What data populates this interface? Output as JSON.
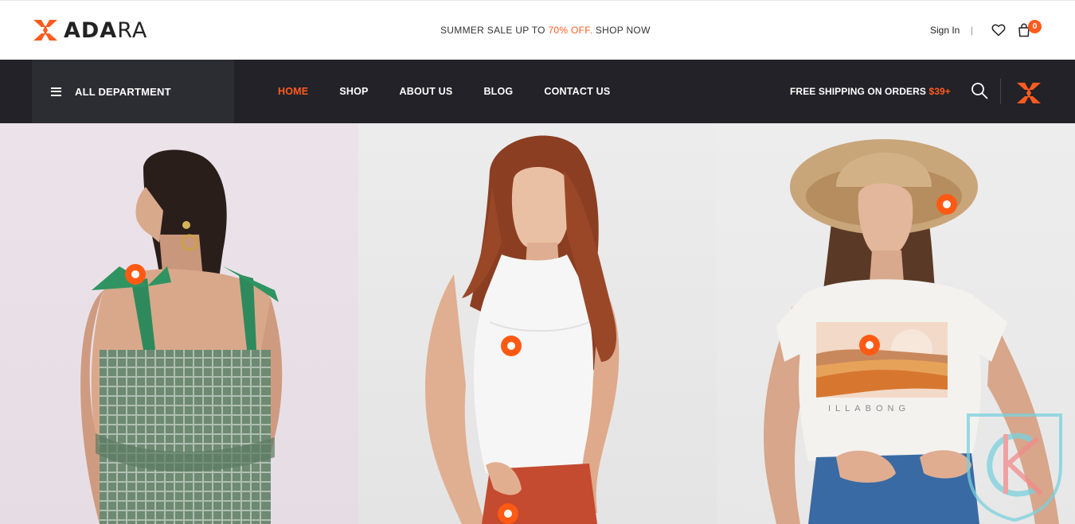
{
  "brand": {
    "name_bold": "ADA",
    "name_light": "RA",
    "accent_color": "#ff5b1f"
  },
  "topbar": {
    "promo_prefix": "SUMMER SALE UP TO",
    "promo_highlight": "70% OFF.",
    "promo_suffix": "SHOP NOW",
    "sign_in": "Sign In",
    "separator": "|",
    "cart_count": "0",
    "icons": [
      "heart-icon",
      "shopping-bag-icon"
    ]
  },
  "nav": {
    "department_label": "ALL DEPARTMENT",
    "items": [
      {
        "label": "HOME",
        "active": true
      },
      {
        "label": "SHOP",
        "active": false
      },
      {
        "label": "ABOUT US",
        "active": false
      },
      {
        "label": "BLOG",
        "active": false
      },
      {
        "label": "CONTACT US",
        "active": false
      }
    ],
    "shipping_text": "FREE SHIPPING ON ORDERS",
    "shipping_amount": "$39+",
    "icons": [
      "menu-icon",
      "search-icon",
      "brand-mark-icon"
    ]
  },
  "lookbook": {
    "panels": [
      {
        "model": "Woman in green gingham top with bow straps",
        "background": "#e9e0e7"
      },
      {
        "model": "Woman in white sleeveless top and red pants",
        "background": "#e8e8e8"
      },
      {
        "model": "Woman in straw hat and printed white tee",
        "background": "#eaeaea"
      }
    ],
    "print_text": "ILLABONG"
  }
}
